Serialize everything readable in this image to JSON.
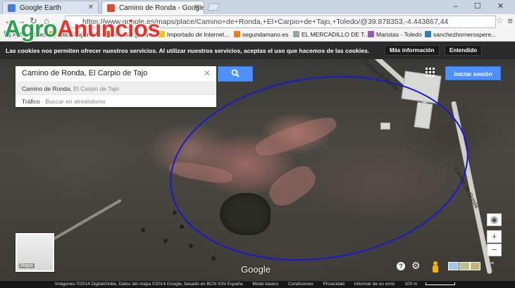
{
  "tabs": [
    {
      "label": "Google Earth",
      "active": false,
      "favicon_color": "#4a7bd6"
    },
    {
      "label": "Camino de Ronda - Google M",
      "active": true,
      "favicon_color": "#d94a3a"
    }
  ],
  "address": "https://www.google.es/maps/place/Camino+de+Ronda,+El+Carpio+de+Tajo,+Toledo/@39.878353,-4.443867,44",
  "bookmarks": [
    {
      "label": "Aplicaciones",
      "icon_color": "#4a7bd6"
    },
    {
      "label": "Sitios sugeridos",
      "icon_color": "#f39c12"
    },
    {
      "label": "Hotmail gratuito",
      "icon_color": "#e74c3c"
    },
    {
      "label": "Importado de Internet...",
      "icon_color": "#f1c40f"
    },
    {
      "label": "segundamano.es",
      "icon_color": "#e67e22"
    },
    {
      "label": "EL MERCADILLO DE T...",
      "icon_color": "#95a5a6"
    },
    {
      "label": "Maristas - Toledo",
      "icon_color": "#9b59b6"
    },
    {
      "label": "sanchezhornerospere...",
      "icon_color": "#2980b9"
    }
  ],
  "cookie_bar": {
    "text": "Las cookies nos permiten ofrecer nuestros servicios. Al utilizar nuestros servicios, aceptas el uso que hacemos de las cookies.",
    "more_info": "Más información",
    "ok": "Entendido"
  },
  "search": {
    "value": "Camino de Ronda, El Carpio de Tajo",
    "suggestions": [
      {
        "main": "Camino de Ronda,",
        "sub": " El Carpio de Tajo"
      },
      {
        "main": "Tráfico",
        "sub": " · Buscar en alrededores"
      }
    ]
  },
  "signin_label": "Iniciar sesión",
  "map": {
    "road_label_1": "Camino de Ronda",
    "road_label_2": "Camino de Ronda",
    "annotation_color": "#1a1acc",
    "minimap_label": "Mapa",
    "google_logo": "Google"
  },
  "footer": {
    "attribution": "Imágenes ©2014 DigitalGlobe, Datos del mapa ©2014 Google, basado en BCN IGN España",
    "mode": "Modo básico",
    "terms": "Condiciones",
    "privacy": "Privacidad",
    "report": "Informar de un error",
    "scale": "100 m"
  },
  "watermark": {
    "part1": "Agro",
    "part2": "Anuncios"
  }
}
